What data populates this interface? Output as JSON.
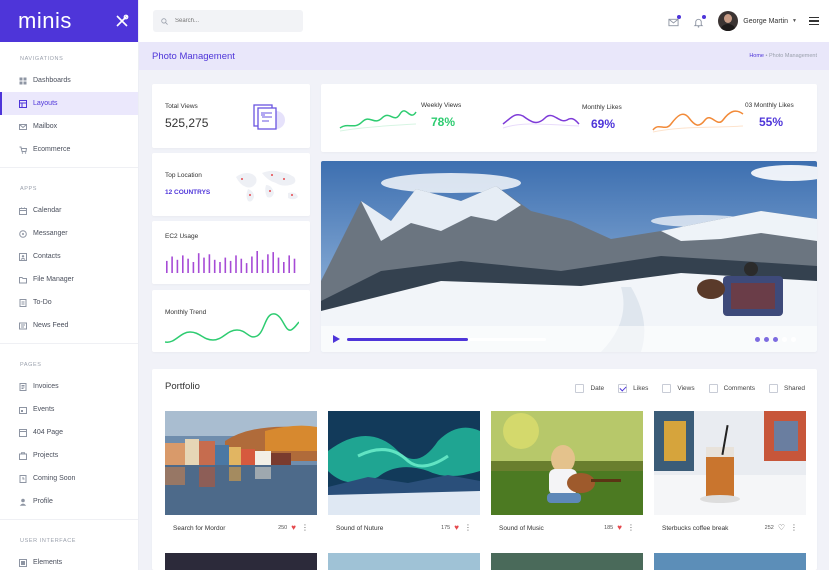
{
  "app": {
    "name": "minis"
  },
  "sidebar": {
    "sections": [
      {
        "title": "NAVIGATIONS",
        "items": [
          {
            "label": "Dashboards",
            "icon": "dashboard-icon"
          },
          {
            "label": "Layouts",
            "icon": "layout-icon",
            "active": true
          },
          {
            "label": "Mailbox",
            "icon": "mail-icon"
          },
          {
            "label": "Ecommerce",
            "icon": "cart-icon"
          }
        ]
      },
      {
        "title": "APPS",
        "items": [
          {
            "label": "Calendar",
            "icon": "calendar-icon"
          },
          {
            "label": "Messanger",
            "icon": "chat-icon"
          },
          {
            "label": "Contacts",
            "icon": "contacts-icon"
          },
          {
            "label": "File Manager",
            "icon": "folder-icon"
          },
          {
            "label": "To-Do",
            "icon": "checklist-icon"
          },
          {
            "label": "News Feed",
            "icon": "news-icon"
          }
        ]
      },
      {
        "title": "PAGES",
        "items": [
          {
            "label": "Invoices",
            "icon": "invoice-icon"
          },
          {
            "label": "Events",
            "icon": "events-icon"
          },
          {
            "label": "404 Page",
            "icon": "error-icon"
          },
          {
            "label": "Projects",
            "icon": "projects-icon"
          },
          {
            "label": "Coming Soon",
            "icon": "clock-icon"
          },
          {
            "label": "Profile",
            "icon": "user-icon"
          }
        ]
      },
      {
        "title": "USER INTERFACE",
        "items": [
          {
            "label": "Elements",
            "icon": "elements-icon"
          }
        ]
      }
    ]
  },
  "topbar": {
    "search_placeholder": "Search...",
    "user_name": "George Martin"
  },
  "page": {
    "title": "Photo Management",
    "breadcrumb": {
      "home": "Home",
      "separator": "•",
      "current": "Photo Management"
    }
  },
  "widgets": {
    "total_views": {
      "label": "Total Views",
      "value": "525,275"
    },
    "top_location": {
      "label": "Top Location",
      "value": "12 COUNTRYS"
    },
    "ec2_usage": {
      "label": "EC2 Usage",
      "bars": [
        0.55,
        0.75,
        0.6,
        0.8,
        0.65,
        0.5,
        0.9,
        0.7,
        0.85,
        0.6,
        0.5,
        0.7,
        0.55,
        0.8,
        0.65,
        0.45,
        0.75,
        1.0,
        0.6,
        0.85,
        0.95,
        0.7,
        0.5,
        0.8,
        0.65
      ]
    },
    "monthly_trend": {
      "label": "Monthly Trend"
    },
    "weekly_views": {
      "label": "Weekly Views",
      "value": "78%",
      "color": "#2ecc71"
    },
    "monthly_likes": {
      "label": "Monthly Likes",
      "value": "69%",
      "color": "#7e3bd8"
    },
    "monthly_likes_03": {
      "label": "03 Monthly Likes",
      "value": "55%",
      "color": "#f28a38"
    }
  },
  "video": {
    "progress": 0.61
  },
  "portfolio": {
    "title": "Portfolio",
    "filters": [
      {
        "label": "Date",
        "checked": false
      },
      {
        "label": "Likes",
        "checked": true
      },
      {
        "label": "Views",
        "checked": false
      },
      {
        "label": "Comments",
        "checked": false
      },
      {
        "label": "Shared",
        "checked": false
      }
    ],
    "items": [
      {
        "title": "Search for Mordor",
        "likes": "250",
        "liked": true
      },
      {
        "title": "Sound of Nuture",
        "likes": "175",
        "liked": true
      },
      {
        "title": "Sound of Music",
        "likes": "185",
        "liked": true
      },
      {
        "title": "Sterbucks coffee break",
        "likes": "252",
        "liked": false
      }
    ]
  },
  "colors": {
    "accent": "#4e35d9",
    "accent_light": "#e9e7fa",
    "heart": "#e5484d"
  }
}
